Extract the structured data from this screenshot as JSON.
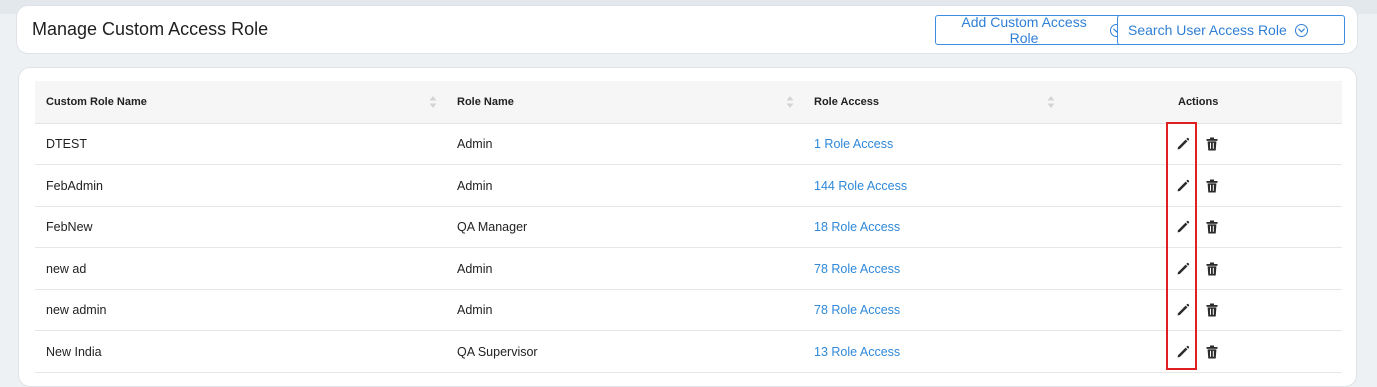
{
  "header": {
    "title": "Manage Custom Access Role",
    "add_button": "Add Custom Access Role",
    "search_button": "Search User Access Role"
  },
  "table": {
    "columns": [
      "Custom Role Name",
      "Role Name",
      "Role Access",
      "Actions"
    ],
    "rows": [
      {
        "custom_role": "DTEST",
        "role": "Admin",
        "access": "1 Role Access"
      },
      {
        "custom_role": "FebAdmin",
        "role": "Admin",
        "access": "144 Role Access"
      },
      {
        "custom_role": "FebNew",
        "role": "QA Manager",
        "access": "18 Role Access"
      },
      {
        "custom_role": "new ad",
        "role": "Admin",
        "access": "78 Role Access"
      },
      {
        "custom_role": "new admin",
        "role": "Admin",
        "access": "78 Role Access"
      },
      {
        "custom_role": "New India",
        "role": "QA Supervisor",
        "access": "13 Role Access"
      }
    ]
  },
  "icons": {
    "button_chevron": "chevron-down-icon",
    "sort": "sort-icon",
    "edit": "pencil-icon",
    "delete": "trash-icon"
  },
  "colors": {
    "accent": "#2f88d8",
    "highlight": "#e02020"
  }
}
